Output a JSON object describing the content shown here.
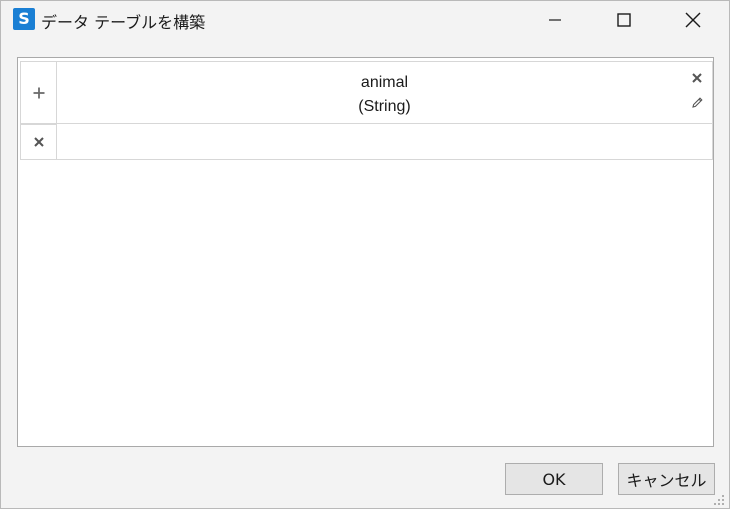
{
  "window": {
    "title": "データ テーブルを構築",
    "app_icon_glyph": "S"
  },
  "grid": {
    "add_column_icon": "plus-icon",
    "delete_row_icon": "close-icon",
    "columns": [
      {
        "name": "animal",
        "type": "(String)"
      }
    ],
    "rows": [
      [
        ""
      ]
    ]
  },
  "buttons": {
    "ok_label": "OK",
    "cancel_label": "キャンセル"
  },
  "colors": {
    "app_icon": "#1a7fd4",
    "window_bg": "#f3f3f3",
    "grid_border": "#d7d7d7",
    "button_bg": "#e5e5e5"
  }
}
